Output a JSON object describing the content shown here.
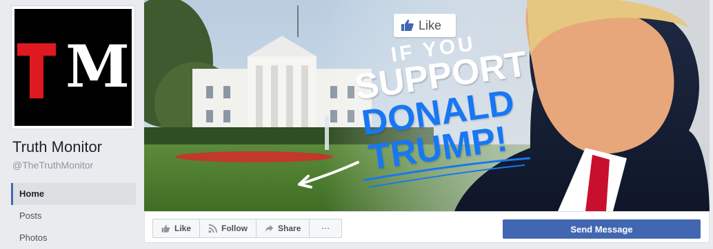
{
  "page": {
    "name": "Truth Monitor",
    "handle": "@TheTruthMonitor"
  },
  "logo": {
    "letters": "TM",
    "t_color": "#e0181f",
    "m_color": "#ffffff",
    "background": "#000000"
  },
  "nav": {
    "items": [
      {
        "label": "Home",
        "active": true
      },
      {
        "label": "Posts",
        "active": false
      },
      {
        "label": "Photos",
        "active": false
      }
    ]
  },
  "cover": {
    "like_badge": "Like",
    "headline": [
      "IF YOU",
      "SUPPORT",
      "DONALD",
      "TRUMP!"
    ]
  },
  "actions": {
    "like": "Like",
    "follow": "Follow",
    "share": "Share",
    "more": "···",
    "send_message": "Send Message"
  },
  "colors": {
    "accent": "#4267b2",
    "headline_blue": "#1877f2"
  }
}
